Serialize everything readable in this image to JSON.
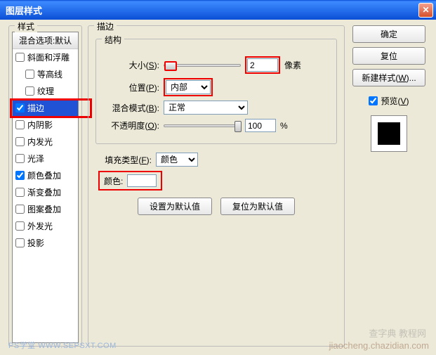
{
  "titlebar": {
    "title": "图层样式"
  },
  "left": {
    "group_title": "样式",
    "header": "混合选项:默认",
    "items": [
      {
        "label": "斜面和浮雕",
        "checked": false,
        "indent": false
      },
      {
        "label": "等高线",
        "checked": false,
        "indent": true
      },
      {
        "label": "纹理",
        "checked": false,
        "indent": true
      },
      {
        "label": "描边",
        "checked": true,
        "indent": false,
        "highlight": true
      },
      {
        "label": "内阴影",
        "checked": false,
        "indent": false
      },
      {
        "label": "内发光",
        "checked": false,
        "indent": false
      },
      {
        "label": "光泽",
        "checked": false,
        "indent": false
      },
      {
        "label": "颜色叠加",
        "checked": true,
        "indent": false
      },
      {
        "label": "渐变叠加",
        "checked": false,
        "indent": false
      },
      {
        "label": "图案叠加",
        "checked": false,
        "indent": false
      },
      {
        "label": "外发光",
        "checked": false,
        "indent": false
      },
      {
        "label": "投影",
        "checked": false,
        "indent": false
      }
    ]
  },
  "center": {
    "main_title": "描边",
    "struct_title": "结构",
    "size_label": "大小",
    "size_key": "S",
    "size_value": "2",
    "size_unit": "像素",
    "position_label": "位置",
    "position_key": "P",
    "position_value": "内部",
    "blend_label": "混合模式",
    "blend_key": "B",
    "blend_value": "正常",
    "opacity_label": "不透明度",
    "opacity_key": "O",
    "opacity_value": "100",
    "opacity_unit": "%",
    "filltype_label": "填充类型",
    "filltype_key": "F",
    "filltype_value": "颜色",
    "color_label": "颜色:",
    "btn_default": "设置为默认值",
    "btn_reset": "复位为默认值"
  },
  "right": {
    "ok": "确定",
    "reset": "复位",
    "newstyle": "新建样式",
    "newstyle_key": "W",
    "preview_label": "预览",
    "preview_key": "V",
    "preview_checked": true
  },
  "watermark_left": "PS学堂  WWW.SEPSXT.COM",
  "watermark_right1": "查字典 教程网",
  "watermark_right2": "jiaocheng.chazidian.com"
}
